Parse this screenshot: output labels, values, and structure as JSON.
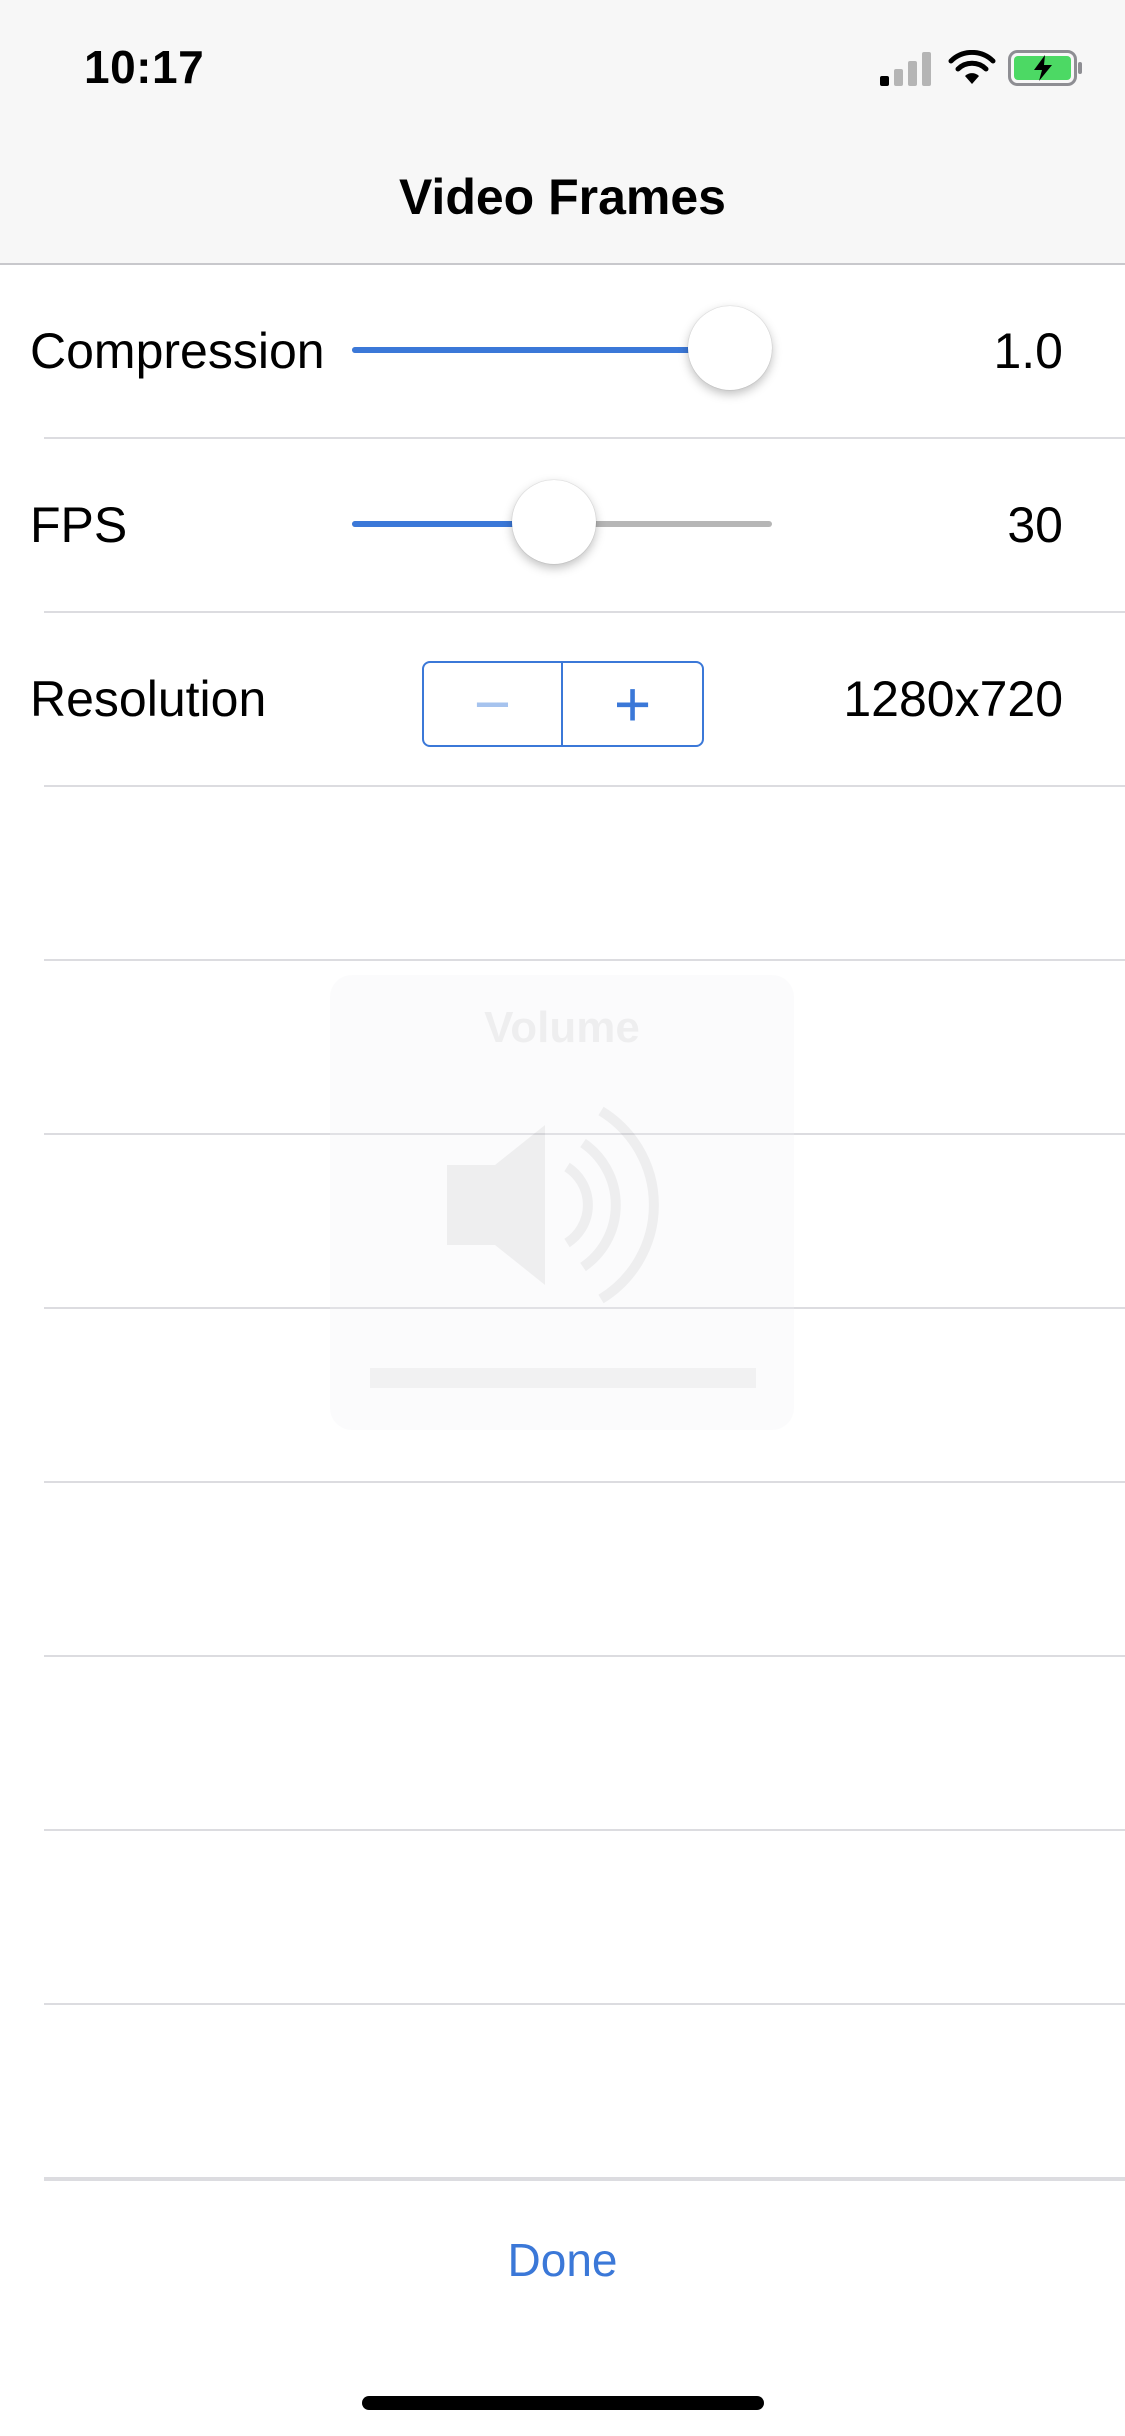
{
  "status_bar": {
    "time": "10:17"
  },
  "nav": {
    "title": "Video Frames"
  },
  "rows": {
    "compression": {
      "label": "Compression",
      "value": "1.0",
      "slider_fraction": 0.9
    },
    "fps": {
      "label": "FPS",
      "value": "30",
      "slider_fraction": 0.48
    },
    "resolution": {
      "label": "Resolution",
      "value": "1280x720",
      "minus_symbol": "−",
      "plus_symbol": "+"
    }
  },
  "volume_hud": {
    "title": "Volume",
    "icon": "speaker-icon"
  },
  "footer": {
    "done_label": "Done"
  },
  "colors": {
    "accent": "#3b78d8",
    "track": "#b6b6b6",
    "separator": "#dcdce0",
    "nav_bg": "#f7f7f7"
  }
}
